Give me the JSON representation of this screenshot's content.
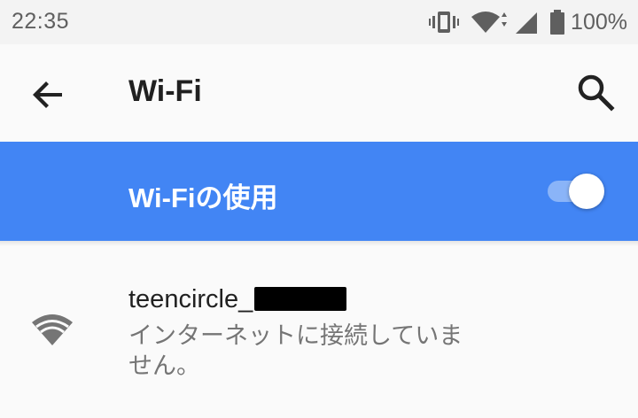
{
  "status_bar": {
    "time": "22:35",
    "battery_percent": "100%",
    "icons": [
      "vibrate-icon",
      "wifi-signal-icon",
      "cell-signal-icon",
      "battery-icon"
    ]
  },
  "toolbar": {
    "title": "Wi-Fi",
    "back_icon": "arrow-back-icon",
    "search_icon": "search-icon"
  },
  "master_switch": {
    "label": "Wi-Fiの使用",
    "enabled": true
  },
  "networks": [
    {
      "ssid": "teencircle_",
      "ssid_redacted": true,
      "summary": "インターネットに接続していません。",
      "icon": "wifi-signal-icon"
    }
  ],
  "colors": {
    "accent": "#4285f4",
    "toggle_track": "#8ab4f8",
    "text_primary": "#212121",
    "text_secondary": "#757575"
  }
}
